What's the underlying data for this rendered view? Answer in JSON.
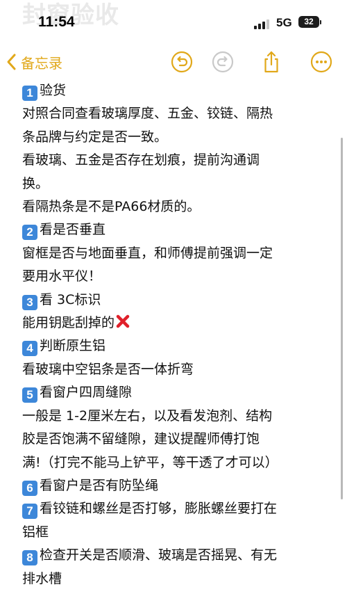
{
  "background_text": {
    "title": "封窗验收"
  },
  "status_bar": {
    "time": "11:54",
    "network": "5G",
    "battery": "32"
  },
  "nav": {
    "back_label": "备忘录",
    "accent_color": "#e1a81a"
  },
  "note": {
    "lines": [
      {
        "badge": "1",
        "text": "验货"
      },
      {
        "text": "对照合同查看玻璃厚度、五金、铰链、隔热"
      },
      {
        "text": "条品牌与约定是否一致。"
      },
      {
        "text": "看玻璃、五金是否存在划痕，提前沟通调"
      },
      {
        "text": "换。"
      },
      {
        "text": "看隔热条是不是PA66材质的。"
      },
      {
        "badge": "2",
        "text": "看是否垂直"
      },
      {
        "text": "窗框是否与地面垂直，和师傅提前强调一定"
      },
      {
        "text": "要用水平仪！"
      },
      {
        "badge": "3",
        "text": "看 3C标识"
      },
      {
        "text": "能用钥匙刮掉的",
        "cross_icon": "red-cross-mark-icon"
      },
      {
        "badge": "4",
        "text": "判断原生铝"
      },
      {
        "text": "看玻璃中空铝条是否一体折弯"
      },
      {
        "badge": "5",
        "text": "看窗户四周缝隙"
      },
      {
        "text": "一般是 1-2厘米左右，以及看发泡剂、结构"
      },
      {
        "text": "胶是否饱满不留缝隙，建议提醒师傅打饱"
      },
      {
        "text": "满!（打完不能马上铲平，等干透了才可以）"
      },
      {
        "badge": "6",
        "text": "看窗户是否有防坠绳"
      },
      {
        "badge": "7",
        "text": "看铰链和螺丝是否打够，膨胀螺丝要打在"
      },
      {
        "text": "铝框"
      },
      {
        "badge": "8",
        "text": "检查开关是否顺滑、玻璃是否摇晃、有无"
      },
      {
        "text": "排水槽"
      }
    ],
    "badge_color": "#3d87d9"
  }
}
